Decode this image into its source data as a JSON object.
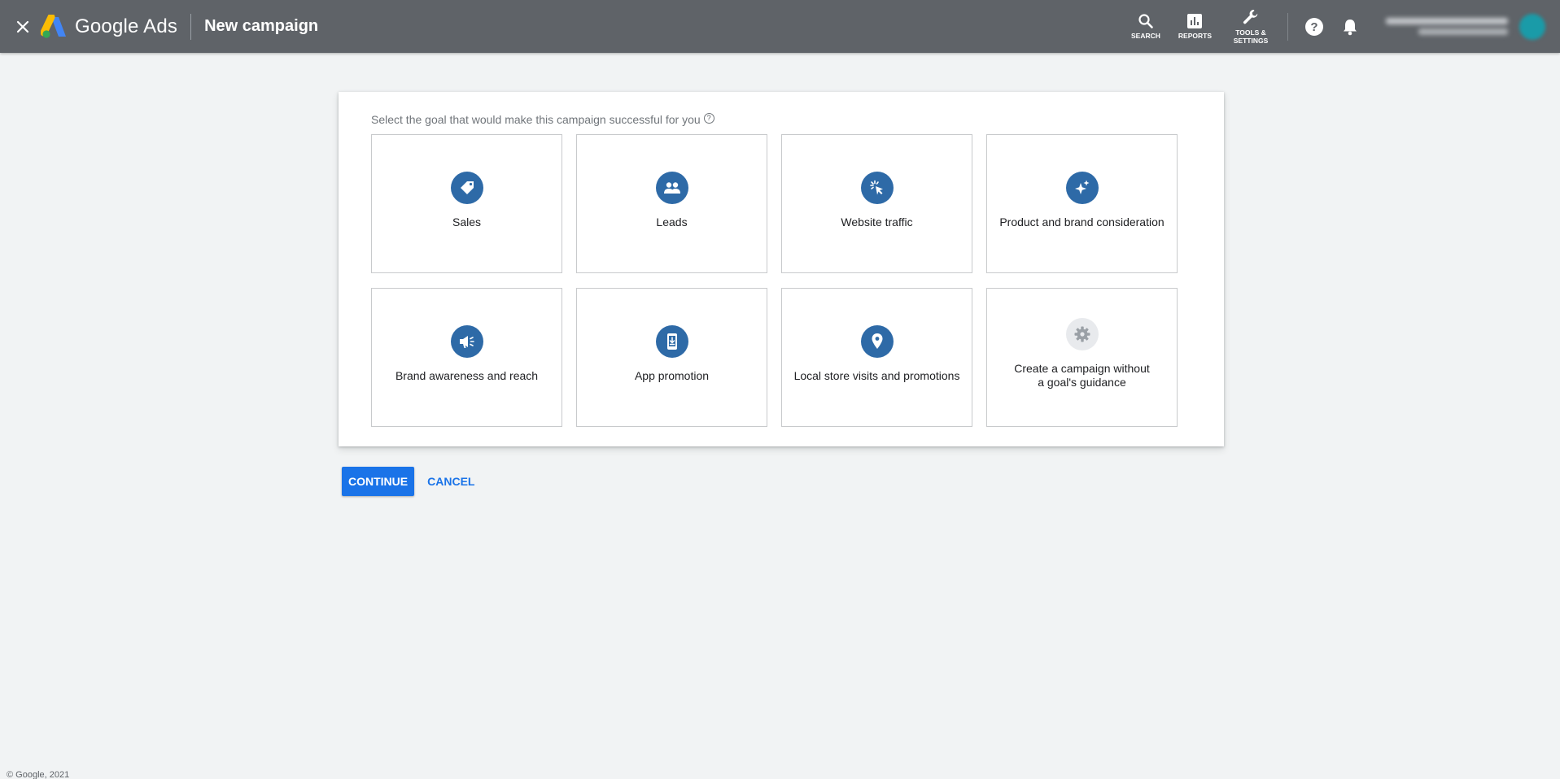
{
  "header": {
    "brand": "Google Ads",
    "page_title": "New campaign",
    "tools": [
      {
        "label": "SEARCH",
        "icon": "search-icon"
      },
      {
        "label": "REPORTS",
        "icon": "bar-chart-icon"
      },
      {
        "label": "TOOLS & SETTINGS",
        "icon": "wrench-icon"
      }
    ]
  },
  "goal_prompt": "Select the goal that would make this campaign successful for you",
  "goals": [
    {
      "label": "Sales",
      "icon": "tag-icon"
    },
    {
      "label": "Leads",
      "icon": "people-icon"
    },
    {
      "label": "Website traffic",
      "icon": "cursor-click-icon"
    },
    {
      "label": "Product and brand consideration",
      "icon": "sparkle-icon"
    },
    {
      "label": "Brand awareness and reach",
      "icon": "megaphone-icon"
    },
    {
      "label": "App promotion",
      "icon": "phone-download-icon"
    },
    {
      "label": "Local store visits and promotions",
      "icon": "location-pin-icon"
    },
    {
      "label": "Create a campaign without a goal's guidance",
      "icon": "gear-icon"
    }
  ],
  "actions": {
    "continue": "CONTINUE",
    "cancel": "CANCEL"
  },
  "footer": "© Google, 2021",
  "colors": {
    "header_bg": "#5f6368",
    "accent": "#1a73e8",
    "goal_icon_bg": "#2e6aa7",
    "page_bg": "#f1f3f4"
  }
}
